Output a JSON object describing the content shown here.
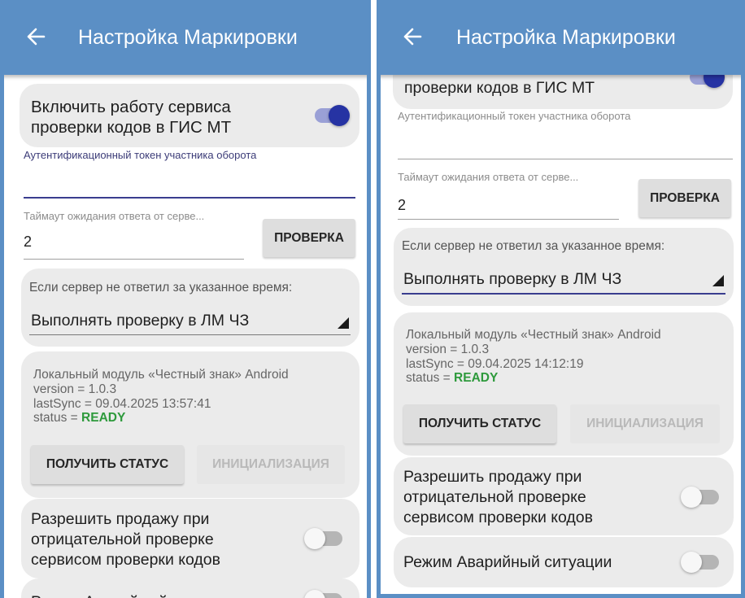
{
  "left": {
    "appbar": {
      "back_icon": "arrow-left-icon",
      "title": "Настройка Маркировки"
    },
    "service_toggle": {
      "label_line1": "Включить работу сервиса",
      "label_line2": "проверки кодов в ГИС МТ",
      "on": true
    },
    "token": {
      "label": "Аутентификационный токен участника оборота",
      "value": ""
    },
    "timeout": {
      "label": "Таймаут ожидания ответа от серве...",
      "value": "2"
    },
    "check_button": "ПРОВЕРКА",
    "no_response": {
      "label": "Если сервер не ответил за указанное время:",
      "selected": "Выполнять проверку в ЛМ ЧЗ"
    },
    "local_module": {
      "line1": "Локальный модуль «Честный знак» Android",
      "line2": "version = 1.0.3",
      "line3": "lastSync = 09.04.2025 13:57:41",
      "status_prefix": "status = ",
      "status_value": "READY"
    },
    "get_status_button": "ПОЛУЧИТЬ СТАТУС",
    "init_button": "ИНИЦИАЛИЗАЦИЯ",
    "allow_sale": {
      "line1": "Разрешить продажу при",
      "line2": "отрицательной проверке",
      "line3": "сервисом проверки кодов",
      "on": false
    },
    "emergency": {
      "label": "Режим Аварийный ситуации",
      "on": false
    }
  },
  "right": {
    "appbar": {
      "back_icon": "arrow-left-icon",
      "title": "Настройка Маркировки"
    },
    "service_toggle": {
      "label_line2": "проверки кодов в ГИС МТ",
      "on": true
    },
    "token": {
      "label": "Аутентификационный токен участника оборота",
      "value": ""
    },
    "timeout": {
      "label": "Таймаут ожидания ответа от серве...",
      "value": "2"
    },
    "check_button": "ПРОВЕРКА",
    "no_response": {
      "label": "Если сервер не ответил за указанное время:",
      "selected": "Выполнять проверку в ЛМ ЧЗ"
    },
    "local_module": {
      "line1": "Локальный модуль «Честный знак» Android",
      "line2": "version = 1.0.3",
      "line3": "lastSync = 09.04.2025 14:12:19",
      "status_prefix": "status = ",
      "status_value": "READY"
    },
    "get_status_button": "ПОЛУЧИТЬ СТАТУС",
    "init_button": "ИНИЦИАЛИЗАЦИЯ",
    "allow_sale": {
      "line1": "Разрешить продажу при",
      "line2": "отрицательной проверке",
      "line3": "сервисом проверки кодов",
      "on": false
    },
    "emergency": {
      "label": "Режим Аварийный ситуации",
      "on": false
    }
  },
  "colors": {
    "appbar": "#5b8fc5",
    "accent": "#2633a3",
    "ready": "#2e9a3c",
    "card": "#ebebeb"
  }
}
